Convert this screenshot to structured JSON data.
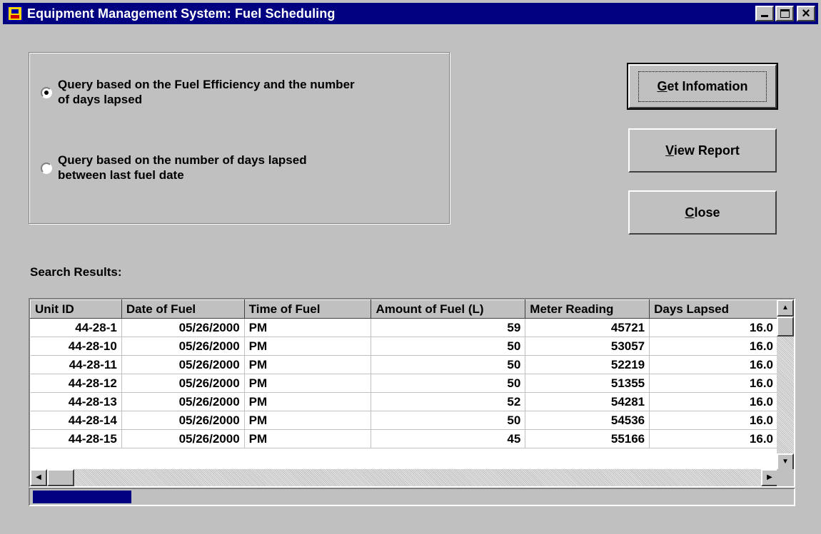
{
  "window": {
    "title": "Equipment Management System: Fuel Scheduling"
  },
  "options": [
    {
      "label": "Query based on the Fuel Efficiency and the number of days lapsed",
      "checked": true
    },
    {
      "label": "Query based on the number of days lapsed between last fuel date",
      "checked": false
    }
  ],
  "buttons": {
    "get_info": "Get Infomation",
    "view_report": "View Report",
    "close": "Close"
  },
  "results": {
    "label": "Search Results:",
    "columns": [
      "Unit ID",
      "Date of Fuel",
      "Time of Fuel",
      "Amount of Fuel (L)",
      "Meter Reading",
      "Days Lapsed"
    ],
    "rows": [
      [
        "44-28-1",
        "05/26/2000",
        "PM",
        "59",
        "45721",
        "16.0"
      ],
      [
        "44-28-10",
        "05/26/2000",
        "PM",
        "50",
        "53057",
        "16.0"
      ],
      [
        "44-28-11",
        "05/26/2000",
        "PM",
        "50",
        "52219",
        "16.0"
      ],
      [
        "44-28-12",
        "05/26/2000",
        "PM",
        "50",
        "51355",
        "16.0"
      ],
      [
        "44-28-13",
        "05/26/2000",
        "PM",
        "52",
        "54281",
        "16.0"
      ],
      [
        "44-28-14",
        "05/26/2000",
        "PM",
        "50",
        "54536",
        "16.0"
      ],
      [
        "44-28-15",
        "05/26/2000",
        "PM",
        "45",
        "55166",
        "16.0"
      ]
    ]
  },
  "progress": {
    "fraction": 0.13
  },
  "colors": {
    "titlebar": "#000080",
    "face": "#c0c0c0",
    "progress": "#000080"
  }
}
